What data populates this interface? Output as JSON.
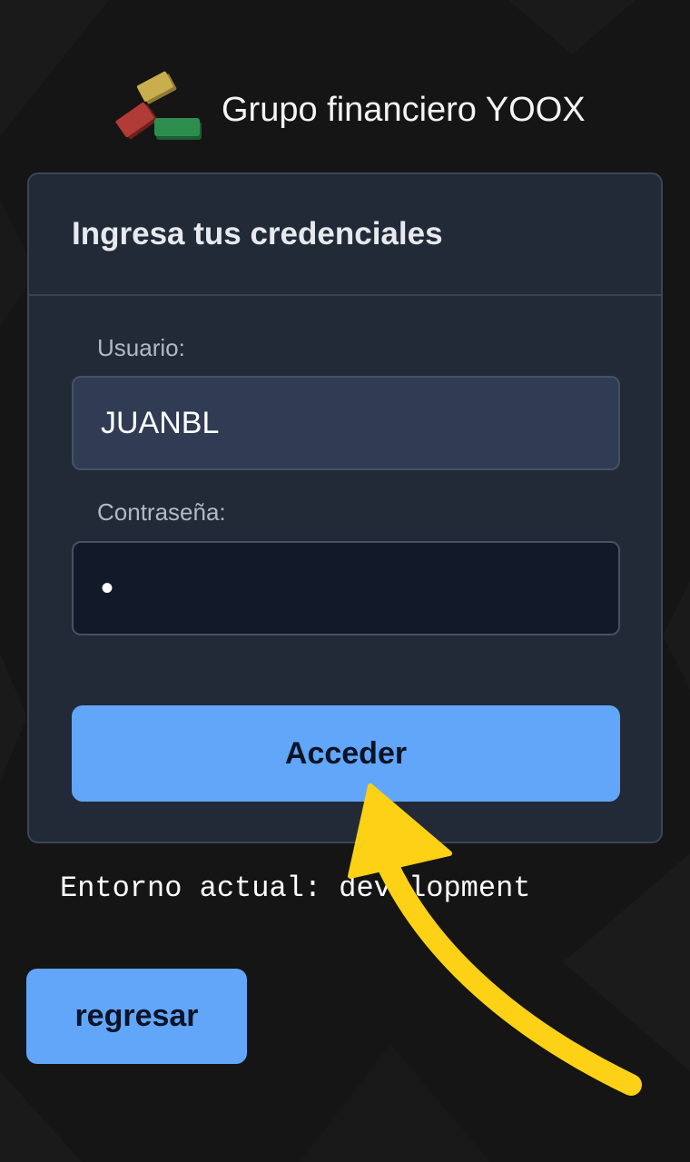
{
  "brand": {
    "title": "Grupo financiero YOOX",
    "logo_icon": "stacked-blocks-logo",
    "logo_colors": [
      "#c5a94a",
      "#b03a35",
      "#2b8a4c"
    ]
  },
  "login_card": {
    "title": "Ingresa tus credenciales",
    "username_label": "Usuario:",
    "username_value": "JUANBL",
    "password_label": "Contraseña:",
    "password_value": "•",
    "submit_label": "Acceder"
  },
  "environment_text": "Entorno actual: development",
  "back_button_label": "regresar",
  "colors": {
    "background": "#151515",
    "card": "#222a38",
    "accent": "#62a6fa",
    "annotation_arrow": "#fcd116"
  }
}
